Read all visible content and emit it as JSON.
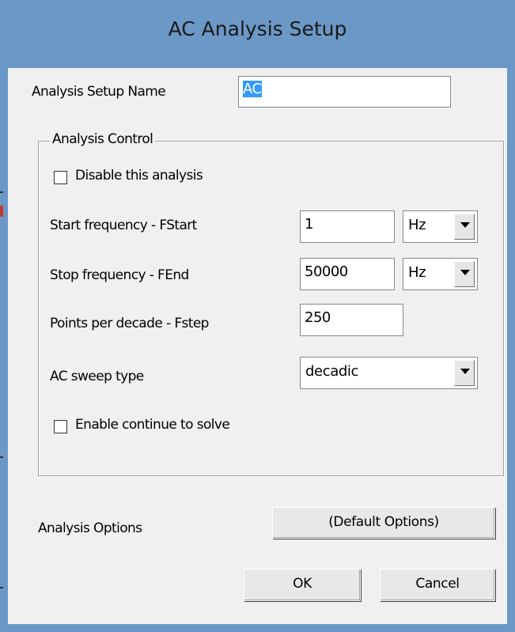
{
  "window": {
    "title": "AC Analysis Setup"
  },
  "setup_name": {
    "label": "Analysis Setup Name",
    "value": "AC"
  },
  "analysis_control": {
    "group_label": "Analysis Control",
    "disable_checkbox": {
      "label": "Disable this analysis",
      "checked": false
    },
    "start_frequency": {
      "label": "Start frequency - FStart",
      "value": "1",
      "unit": "Hz"
    },
    "stop_frequency": {
      "label": "Stop frequency - FEnd",
      "value": "50000",
      "unit": "Hz"
    },
    "points_per_decade": {
      "label": "Points per decade - Fstep",
      "value": "250"
    },
    "sweep_type": {
      "label": "AC sweep type",
      "value": "decadic"
    },
    "continue_checkbox": {
      "label": "Enable continue to solve",
      "checked": false
    }
  },
  "analysis_options": {
    "label": "Analysis Options",
    "button_label": "(Default Options)"
  },
  "footer": {
    "ok_label": "OK",
    "cancel_label": "Cancel"
  },
  "colors": {
    "title_bar": "#6b98c6",
    "client": "#f0f0f0",
    "selection": "#3399ff"
  },
  "icons": {
    "dropdown": "chevron-down-icon"
  }
}
